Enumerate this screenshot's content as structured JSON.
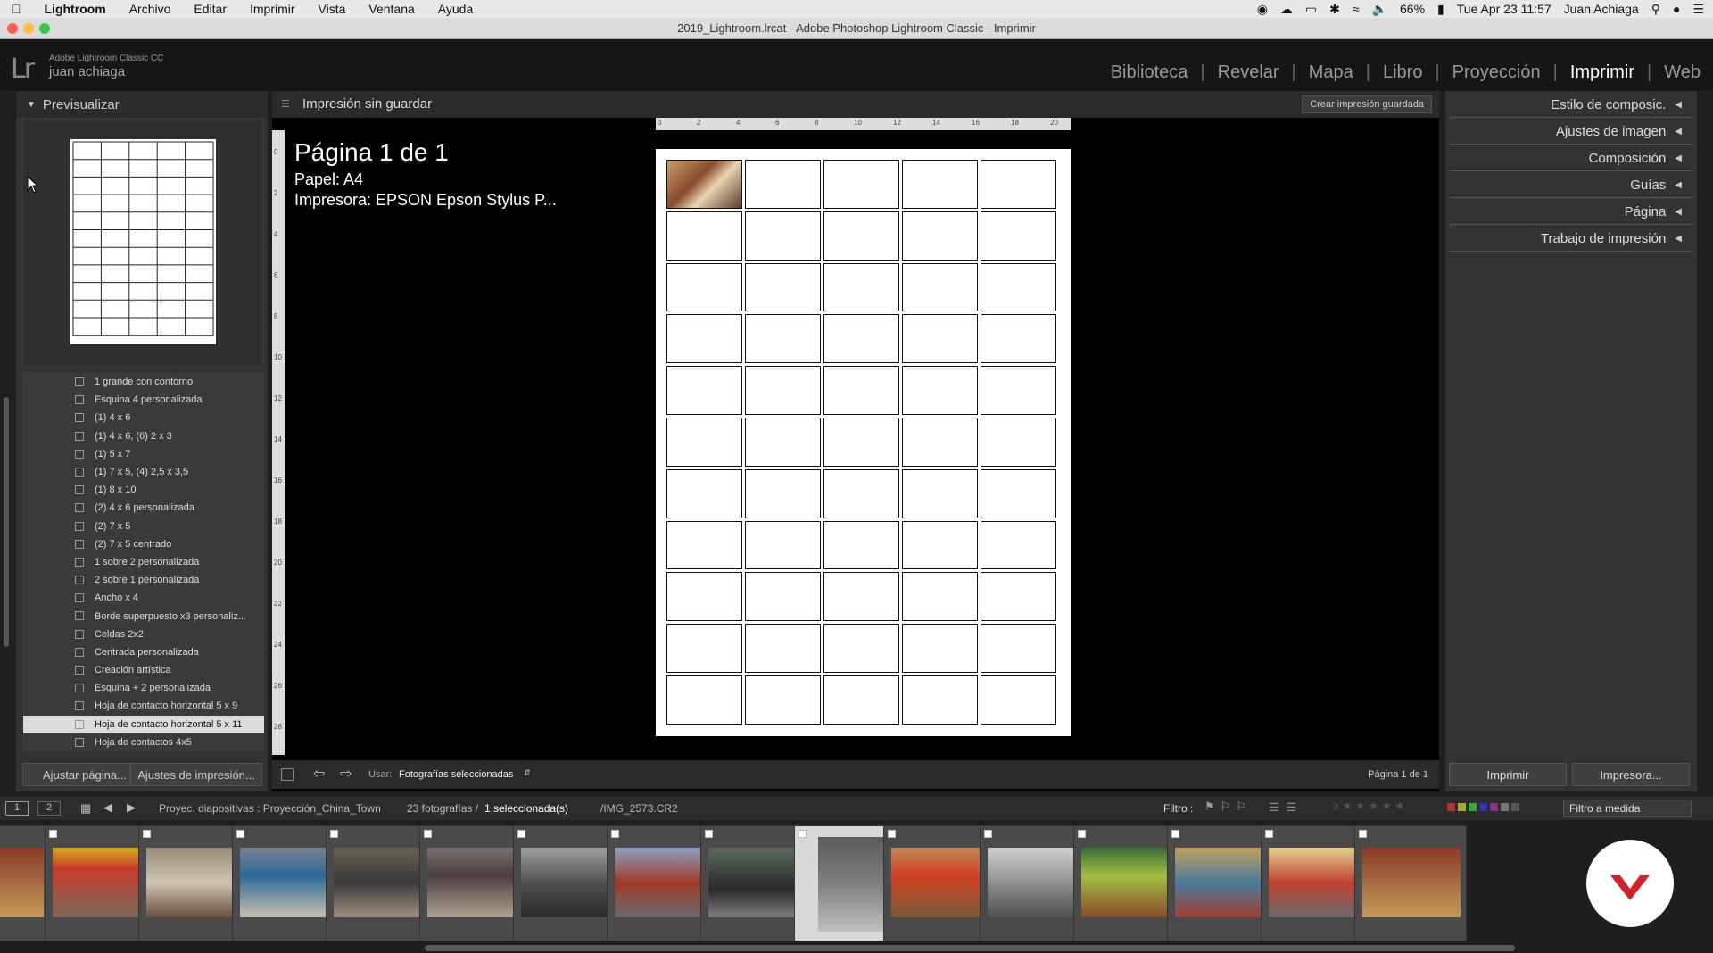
{
  "menubar": {
    "apple": "",
    "items": [
      "Lightroom",
      "Archivo",
      "Editar",
      "Imprimir",
      "Vista",
      "Ventana",
      "Ayuda"
    ],
    "battery": "66%",
    "clock": "Tue Apr 23  11:57",
    "user": "Juan Achiaga"
  },
  "window": {
    "title": "2019_Lightroom.lrcat - Adobe Photoshop Lightroom Classic - Imprimir"
  },
  "identity": {
    "logo": "Lr",
    "product": "Adobe Lightroom Classic CC",
    "user": "juan achiaga"
  },
  "modules": [
    "Biblioteca",
    "Revelar",
    "Mapa",
    "Libro",
    "Proyección",
    "Imprimir",
    "Web"
  ],
  "modules_active": "Imprimir",
  "left": {
    "preview_title": "Previsualizar",
    "templates": [
      "1 grande con contorno",
      "Esquina 4 personalizada",
      "(1) 4 x 6",
      "(1) 4 x 6, (6) 2 x 3",
      "(1) 5 x 7",
      "(1) 7 x 5, (4) 2,5 x 3,5",
      "(1) 8 x 10",
      "(2) 4 x 6 personalizada",
      "(2) 7 x 5",
      "(2) 7 x 5 centrado",
      "1 sobre 2 personalizada",
      "2 sobre 1 personalizada",
      "Ancho x 4",
      "Borde superpuesto x3 personaliz...",
      "Celdas 2x2",
      "Centrada personalizada",
      "Creación artística",
      "Esquina + 2 personalizada",
      "Hoja de contacto horizontal 5 x 9",
      "Hoja de contacto horizontal 5 x 11",
      "Hoja de contactos 4x5"
    ],
    "selected_template": "Hoja de contacto horizontal 5 x 11",
    "btn_page": "Ajustar página...",
    "btn_print_settings": "Ajustes de impresión..."
  },
  "center": {
    "header": "Impresión sin guardar",
    "save_btn": "Crear impresión guardada",
    "page_title": "Página 1 de 1",
    "paper": "Papel: A4",
    "printer": "Impresora: EPSON Epson Stylus P...",
    "ruler_top": [
      "0",
      "2",
      "4",
      "6",
      "8",
      "10",
      "12",
      "14",
      "16",
      "18",
      "20"
    ],
    "ruler_left": [
      "0",
      "2",
      "4",
      "6",
      "8",
      "10",
      "12",
      "14",
      "16",
      "18",
      "20",
      "22",
      "24",
      "26",
      "28"
    ],
    "use_label": "Usar:",
    "use_value": "Fotografías seleccionadas",
    "page_count": "Página 1 de 1"
  },
  "right": {
    "sections": [
      "Estilo de composic.",
      "Ajustes de imagen",
      "Composición",
      "Guías",
      "Página",
      "Trabajo de impresión"
    ],
    "btn_print": "Imprimir",
    "btn_printer": "Impresora..."
  },
  "filmbar": {
    "screen1": "1",
    "screen2": "2",
    "source": "Proyec. diapositivas : Proyección_China_Town",
    "count": "23 fotografías /",
    "selected": "1 seleccionada(s)",
    "file": "/IMG_2573.CR2",
    "filter_label": "Filtro :",
    "filter_value": "Filtro a medida"
  },
  "colors": {
    "accent": "#ffffff",
    "panel": "#333333",
    "brand_red": "#d4202c"
  }
}
